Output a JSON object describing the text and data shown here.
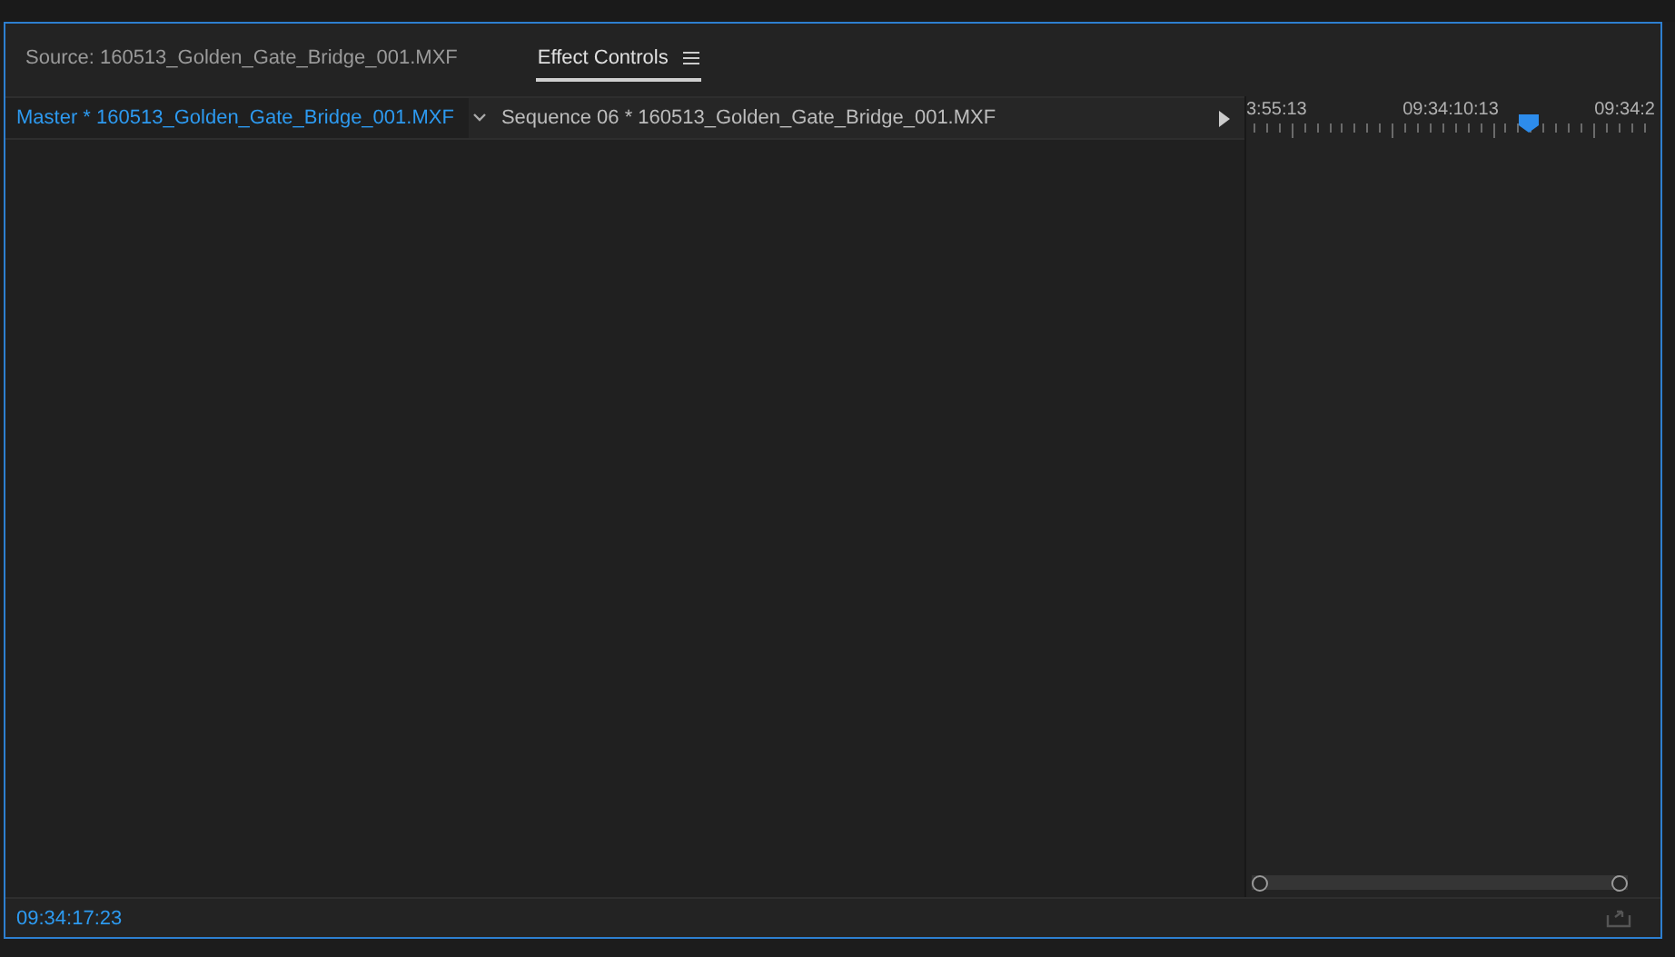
{
  "tabs": [
    {
      "label": "Source: 160513_Golden_Gate_Bridge_001.MXF",
      "selected": false
    },
    {
      "label": "Effect Controls",
      "selected": true,
      "menu_icon": true
    }
  ],
  "clip_header": {
    "master": "Master * 160513_Golden_Gate_Bridge_001.MXF",
    "sequence": "Sequence 06 * 160513_Golden_Gate_Bridge_001.MXF"
  },
  "timeline": {
    "ruler_labels": [
      "3:55:13",
      "09:34:10:13",
      "09:34:2"
    ]
  },
  "timecode": "09:34:17:23"
}
